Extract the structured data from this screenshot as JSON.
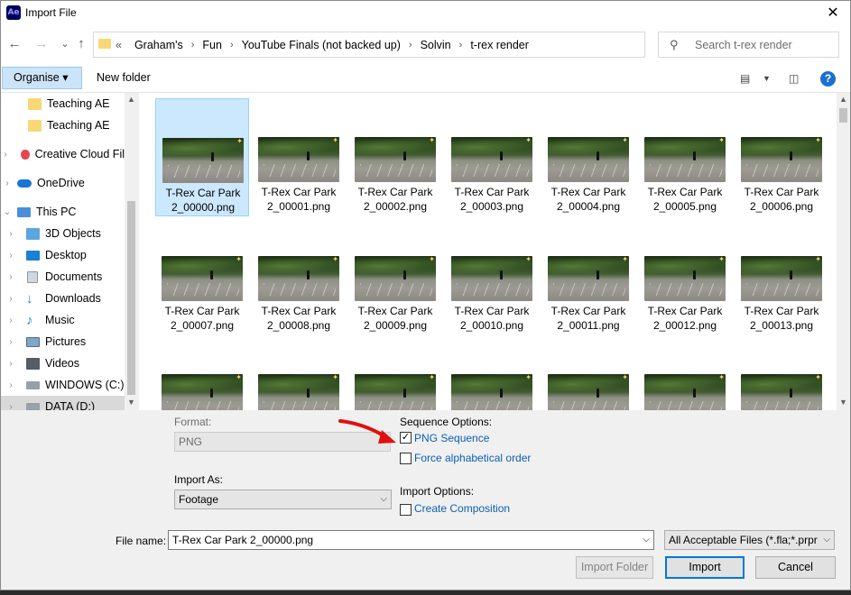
{
  "titlebar": {
    "app_badge": "Ae",
    "title": "Import File",
    "close_glyph": "✕"
  },
  "navigation": {
    "back": "←",
    "forward": "→",
    "recent": "⌄",
    "up": "↑",
    "breadcrumb_overflow": "«",
    "breadcrumbs": [
      "Graham's",
      "Fun",
      "YouTube Finals (not backed up)",
      "Solvin",
      "t-rex render"
    ],
    "separator": "›",
    "search_placeholder": "Search t-rex render"
  },
  "toolbar": {
    "organise": "Organise ▾",
    "new_folder": "New folder"
  },
  "sidebar": {
    "items": [
      {
        "label": "Teaching AE",
        "icon": "folder-icon",
        "color": "#f8d775"
      },
      {
        "label": "Teaching AE",
        "icon": "folder-icon",
        "color": "#f8d775"
      },
      {
        "label": "Creative Cloud Fil",
        "icon": "creative-cloud-icon",
        "color": "#e34850"
      },
      {
        "label": "OneDrive",
        "icon": "onedrive-icon",
        "color": "#1a74d6"
      },
      {
        "label": "This PC",
        "icon": "computer-icon",
        "color": "#4a90d9"
      },
      {
        "label": "3D Objects",
        "icon": "3d-objects-icon",
        "color": "#5aa7e0"
      },
      {
        "label": "Desktop",
        "icon": "desktop-icon",
        "color": "#1a7fd6"
      },
      {
        "label": "Documents",
        "icon": "documents-icon",
        "color": "#d0d7df"
      },
      {
        "label": "Downloads",
        "icon": "downloads-icon",
        "color": "#2f7fd8"
      },
      {
        "label": "Music",
        "icon": "music-icon",
        "color": "#2f7fd8"
      },
      {
        "label": "Pictures",
        "icon": "pictures-icon",
        "color": "#7fa6c9"
      },
      {
        "label": "Videos",
        "icon": "videos-icon",
        "color": "#555c66"
      },
      {
        "label": "WINDOWS (C:)",
        "icon": "drive-c-icon",
        "color": "#9aa0a8"
      },
      {
        "label": "DATA (D:)",
        "icon": "drive-d-icon",
        "color": "#9aa0a8"
      }
    ]
  },
  "files": [
    {
      "line1": "T-Rex Car Park",
      "line2": "2_00000.png"
    },
    {
      "line1": "T-Rex Car Park",
      "line2": "2_00001.png"
    },
    {
      "line1": "T-Rex Car Park",
      "line2": "2_00002.png"
    },
    {
      "line1": "T-Rex Car Park",
      "line2": "2_00003.png"
    },
    {
      "line1": "T-Rex Car Park",
      "line2": "2_00004.png"
    },
    {
      "line1": "T-Rex Car Park",
      "line2": "2_00005.png"
    },
    {
      "line1": "T-Rex Car Park",
      "line2": "2_00006.png"
    },
    {
      "line1": "T-Rex Car Park",
      "line2": "2_00007.png"
    },
    {
      "line1": "T-Rex Car Park",
      "line2": "2_00008.png"
    },
    {
      "line1": "T-Rex Car Park",
      "line2": "2_00009.png"
    },
    {
      "line1": "T-Rex Car Park",
      "line2": "2_00010.png"
    },
    {
      "line1": "T-Rex Car Park",
      "line2": "2_00011.png"
    },
    {
      "line1": "T-Rex Car Park",
      "line2": "2_00012.png"
    },
    {
      "line1": "T-Rex Car Park",
      "line2": "2_00013.png"
    }
  ],
  "options": {
    "format_label": "Format:",
    "format_value": "PNG",
    "import_as_label": "Import As:",
    "import_as_value": "Footage",
    "sequence_options_label": "Sequence Options:",
    "png_sequence": "PNG Sequence",
    "png_sequence_checked": "✓",
    "force_alpha": "Force alphabetical order",
    "import_options_label": "Import Options:",
    "create_composition": "Create Composition"
  },
  "footer": {
    "file_name_label": "File name:",
    "file_name_value": "T-Rex Car Park 2_00000.png",
    "file_type": "All Acceptable Files (*.fla;*.prpr",
    "import_folder": "Import Folder",
    "import": "Import",
    "cancel": "Cancel"
  },
  "accent_color": "#0078d7",
  "annotation_color": "#e01010"
}
